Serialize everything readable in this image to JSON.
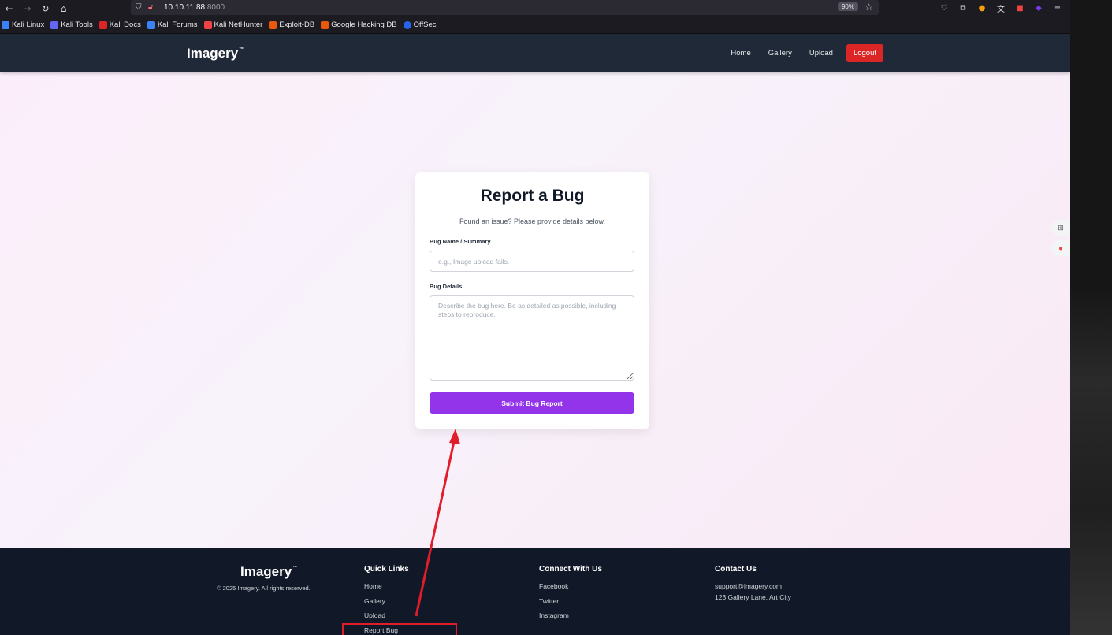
{
  "browser": {
    "url_host": "10.10.11.88",
    "url_port": ":8000",
    "zoom": "90%",
    "bookmarks": [
      "Kali Linux",
      "Kali Tools",
      "Kali Docs",
      "Kali Forums",
      "Kali NetHunter",
      "Exploit-DB",
      "Google Hacking DB",
      "OffSec"
    ],
    "bookmark_colors": [
      "#3b82f6",
      "#6366f1",
      "#dc2626",
      "#3b82f6",
      "#ef4444",
      "#ea580c",
      "#ea580c",
      "#2563eb"
    ]
  },
  "header": {
    "logo": "Imagery",
    "logo_tm": "™",
    "nav": [
      "Home",
      "Gallery",
      "Upload"
    ],
    "logout": "Logout"
  },
  "form": {
    "title": "Report a Bug",
    "subtitle": "Found an issue? Please provide details below.",
    "name_label": "Bug Name / Summary",
    "name_placeholder": "e.g., Image upload fails.",
    "details_label": "Bug Details",
    "details_placeholder": "Describe the bug here. Be as detailed as possible, including steps to reproduce.",
    "submit": "Submit Bug Report"
  },
  "footer": {
    "logo": "Imagery",
    "logo_tm": "™",
    "copyright": "© 2025 Imagery. All rights reserved.",
    "quick_links_title": "Quick Links",
    "quick_links": [
      "Home",
      "Gallery",
      "Upload",
      "Report Bug"
    ],
    "connect_title": "Connect With Us",
    "connect": [
      "Facebook",
      "Twitter",
      "Instagram"
    ],
    "contact_title": "Contact Us",
    "contact": [
      "support@imagery.com",
      "123 Gallery Lane, Art City"
    ]
  },
  "annotation": {
    "color": "#e11d2a"
  },
  "colors": {
    "header_bg": "#1f2937",
    "footer_bg": "#111827",
    "logout": "#dc2626",
    "submit": "#9333ea"
  }
}
